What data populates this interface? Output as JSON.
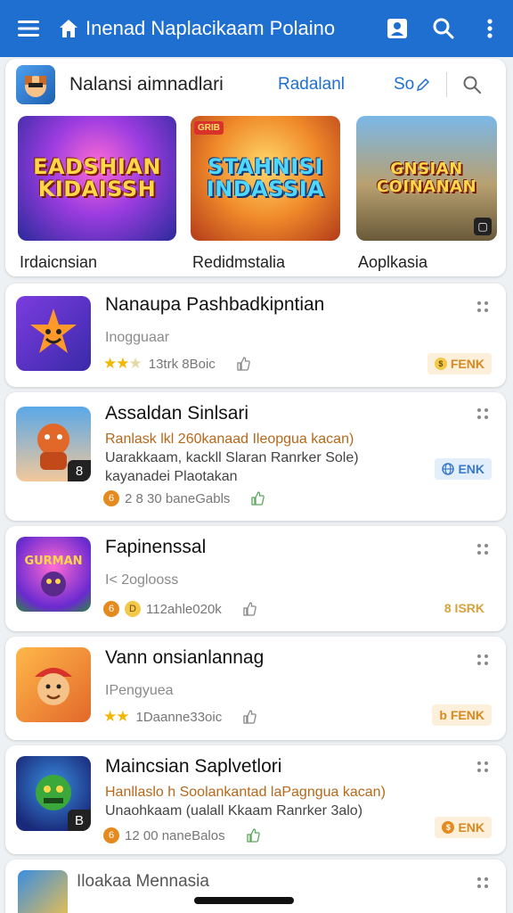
{
  "topbar": {
    "title": "Inenad Naplacikaam Polaino",
    "icons": [
      "menu-icon",
      "home-icon",
      "account-box-icon",
      "search-icon",
      "more-vert-icon"
    ]
  },
  "featured": {
    "title": "Nalansi aimnadlari",
    "link": "Radalanl",
    "tag": "So",
    "promos": [
      {
        "art_text": "EADSHIAN KIDAISSH",
        "caption": "Irdaicnsian"
      },
      {
        "art_text": "STAHNISI INDASSIA",
        "badge": "GRIB",
        "caption": "Redidmstalia"
      },
      {
        "art_text": "GNSIAN COINANAN",
        "caption": "Aoplkasia"
      }
    ]
  },
  "apps": [
    {
      "name": "Nanaupa Pashbadkipntian",
      "developer": "Inogguaar",
      "rating": 2.5,
      "meta": "13trk 8Boic",
      "pill": "FENK",
      "pill_icon": "coin-icon"
    },
    {
      "name": "Assaldan Sinlsari",
      "desc1": "Ranlask lkl 260kanaad Ileopgua kacan)",
      "desc2": "Uarakkaam, kackll Slaran Ranrker Sole)",
      "desc3": "kayanadei Plaotakan",
      "coin": "6",
      "meta": "2 8 30 baneGabls",
      "pill": "ENK",
      "pill_icon": "globe-icon",
      "corner": "8"
    },
    {
      "name": "Fapinenssal",
      "developer": "I< 2oglooss",
      "coin": "6",
      "coin2": "D",
      "meta": "112ahle020k",
      "pill": "8 ISRK"
    },
    {
      "name": "Vann onsianlannag",
      "developer": "IPengyuea",
      "rating": 2,
      "meta": "1Daanne33oic",
      "pill": "FENK",
      "pill_icon": "b"
    },
    {
      "name": "Maincsian Saplvetlori",
      "desc1": "Hanllaslo h Soolankantad laPagngua kacan)",
      "desc2": "Unaohkaam (ualall Kkaam Ranrker 3alo)",
      "coin": "6",
      "meta": "12 00 naneBalos",
      "pill": "ENK",
      "pill_icon": "coin-icon",
      "corner": "B"
    }
  ],
  "bottom": {
    "name": "Iloakaa Mennasia"
  },
  "colors": {
    "brand": "#1f6fd1",
    "accent_orange": "#d98820",
    "accent_blue": "#3a78c8"
  }
}
